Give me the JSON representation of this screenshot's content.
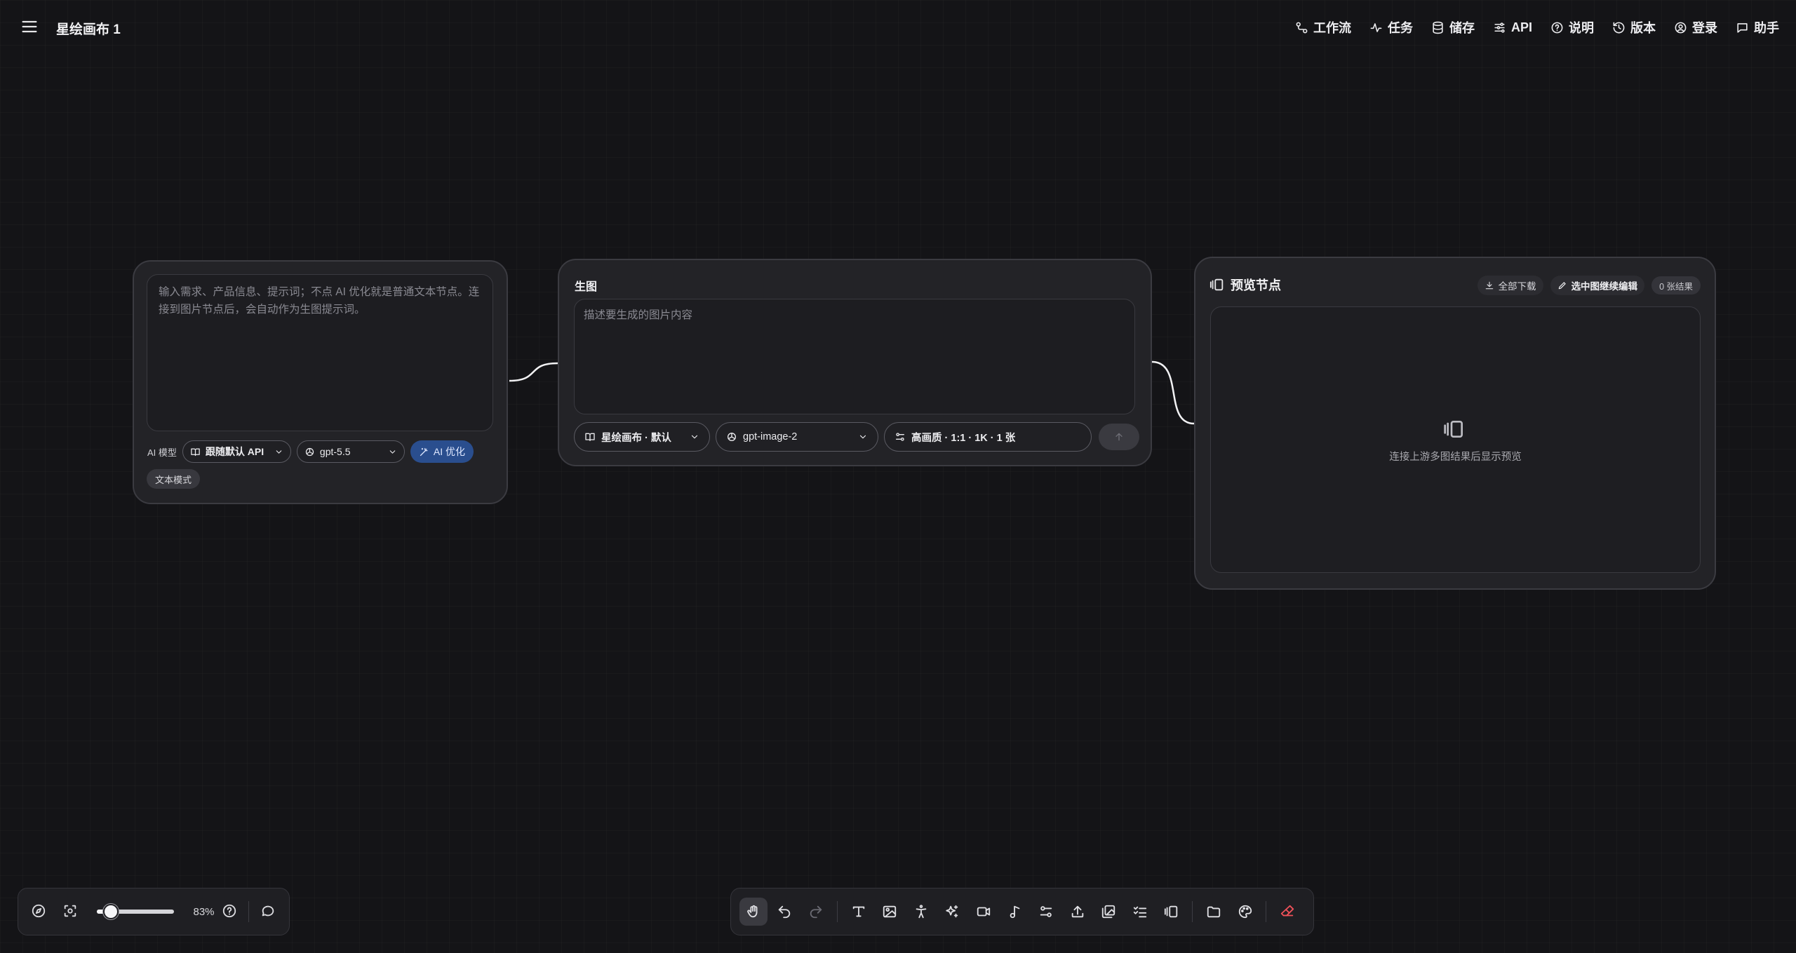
{
  "header": {
    "title": "星绘画布 1",
    "menu_icon": "hamburger-icon",
    "nav": [
      {
        "label": "工作流",
        "icon": "workflow-icon"
      },
      {
        "label": "任务",
        "icon": "activity-icon"
      },
      {
        "label": "储存",
        "icon": "database-icon"
      },
      {
        "label": "API",
        "icon": "sliders-icon"
      },
      {
        "label": "说明",
        "icon": "help-circle-icon"
      },
      {
        "label": "版本",
        "icon": "history-icon"
      },
      {
        "label": "登录",
        "icon": "user-circle-icon"
      },
      {
        "label": "助手",
        "icon": "message-icon"
      }
    ]
  },
  "text_node": {
    "placeholder": "输入需求、产品信息、提示词；不点 AI 优化就是普通文本节点。连接到图片节点后，会自动作为生图提示词。",
    "model_label": "AI 模型",
    "api_select": "跟随默认 API",
    "model_select": "gpt-5.5",
    "optimize_button": "AI 优化",
    "mode_button": "文本模式"
  },
  "image_node": {
    "title": "生图",
    "placeholder": "描述要生成的图片内容",
    "preset_select": "星绘画布 · 默认",
    "model_select": "gpt-image-2",
    "settings_select": "高画质 · 1:1 · 1K · 1 张"
  },
  "preview_node": {
    "title": "预览节点",
    "download_all": "全部下载",
    "edit_selected": "选中图继续编辑",
    "result_count": "0 张结果",
    "empty_text": "连接上游多图结果后显示预览"
  },
  "view_controls": {
    "zoom_percent": 83,
    "zoom_label": "83%"
  },
  "toolbar": {
    "tools": [
      "hand-icon",
      "undo-icon",
      "redo-icon",
      "text-icon",
      "image-icon",
      "figure-icon",
      "sparkles-icon",
      "video-icon",
      "music-icon",
      "settings-icon",
      "upload-icon",
      "images-icon",
      "checklist-icon",
      "preview-icon",
      "folder-icon",
      "palette-icon",
      "eraser-icon"
    ],
    "active_tool": "hand-icon"
  },
  "colors": {
    "background": "#141417",
    "node": "#232327",
    "accent_blue": "#2a4e8e",
    "eraser_red": "#f0525a"
  }
}
